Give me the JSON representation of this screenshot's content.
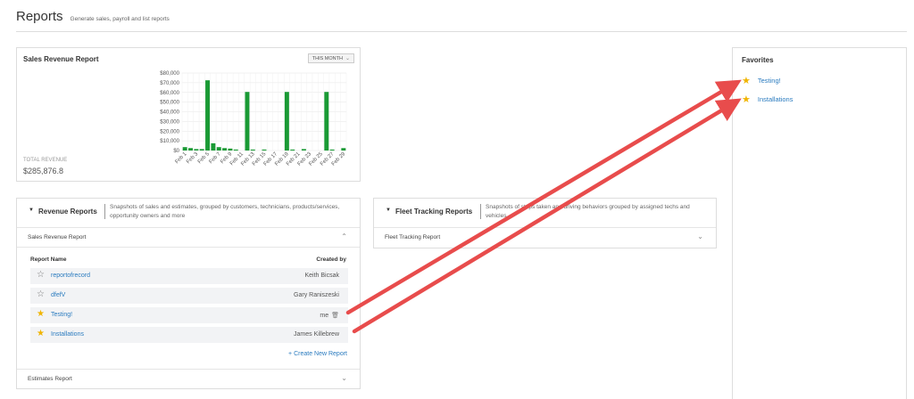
{
  "header": {
    "title": "Reports",
    "subtitle": "Generate sales, payroll and list reports"
  },
  "sales_card": {
    "title": "Sales Revenue Report",
    "period": "THIS MONTH",
    "total_label": "TOTAL REVENUE",
    "total_value": "$285,876.8"
  },
  "chart_data": {
    "type": "bar",
    "title": "",
    "xlabel": "",
    "ylabel": "",
    "ylim": [
      0,
      80000
    ],
    "yticks": [
      "$80,000",
      "$70,000",
      "$60,000",
      "$50,000",
      "$40,000",
      "$30,000",
      "$20,000",
      "$10,000",
      "$0"
    ],
    "categories": [
      "Feb 1",
      "Feb 2",
      "Feb 3",
      "Feb 4",
      "Feb 5",
      "Feb 6",
      "Feb 7",
      "Feb 8",
      "Feb 9",
      "Feb 10",
      "Feb 11",
      "Feb 12",
      "Feb 13",
      "Feb 14",
      "Feb 15",
      "Feb 16",
      "Feb 17",
      "Feb 18",
      "Feb 19",
      "Feb 20",
      "Feb 21",
      "Feb 22",
      "Feb 23",
      "Feb 24",
      "Feb 25",
      "Feb 26",
      "Feb 27",
      "Feb 28",
      "Feb 29"
    ],
    "shown_labels": [
      "Feb 1",
      "Feb 3",
      "Feb 5",
      "Feb 7",
      "Feb 9",
      "Feb 11",
      "Feb 13",
      "Feb 15",
      "Feb 17",
      "Feb 19",
      "Feb 21",
      "Feb 23",
      "Feb 25",
      "Feb 27",
      "Feb 29"
    ],
    "values": [
      3500,
      2500,
      1500,
      1500,
      72500,
      7500,
      3500,
      2500,
      2000,
      1000,
      0,
      60500,
      1000,
      0,
      1000,
      0,
      0,
      0,
      60500,
      1000,
      0,
      1500,
      0,
      0,
      0,
      60500,
      1000,
      0,
      2500
    ],
    "color": "#1a9a35",
    "grid": true
  },
  "revenue_section": {
    "title": "Revenue Reports",
    "description": "Snapshots of sales and estimates, grouped by customers, technicians, products/services, opportunity owners and more",
    "sub_sales": "Sales Revenue Report",
    "col_name": "Report Name",
    "col_by": "Created by",
    "rows": [
      {
        "name": "reportofrecord",
        "owner": "Keith Bicsak",
        "favorite": false
      },
      {
        "name": "dfefV",
        "owner": "Gary Raniszeski",
        "favorite": false
      },
      {
        "name": "Testing!",
        "owner": "me",
        "favorite": true
      },
      {
        "name": "Installations",
        "owner": "James Killebrew",
        "favorite": true
      }
    ],
    "create_link": "+ Create New Report",
    "sub_estimates": "Estimates Report"
  },
  "fleet_section": {
    "title": "Fleet Tracking Reports",
    "description": "Snapshots of stops taken and driving behaviors grouped by assigned techs and vehicles",
    "sub_fleet": "Fleet Tracking Report"
  },
  "favorites": {
    "title": "Favorites",
    "items": [
      "Testing!",
      "Installations"
    ]
  },
  "icons": {
    "star": "star-icon",
    "trash": "trash-icon",
    "chevron": "chevron-icon",
    "caret": "caret-down-icon"
  },
  "colors": {
    "link": "#2a7bbf",
    "star": "#f0b400",
    "bar": "#1a9a35",
    "arrow": "#e84c4c"
  }
}
